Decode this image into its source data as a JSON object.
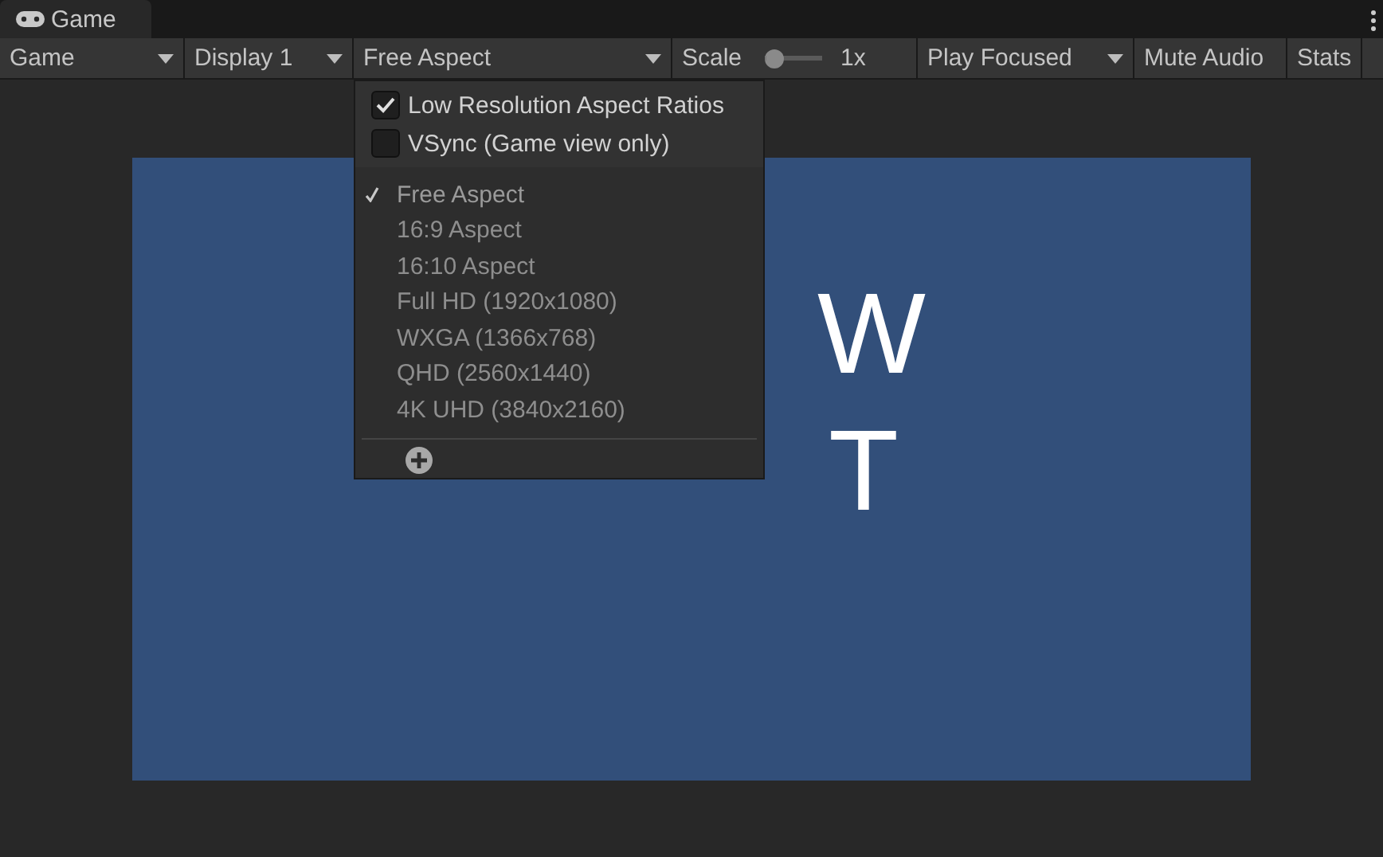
{
  "tab": {
    "title": "Game"
  },
  "toolbar": [
    {
      "kind": "dropdown",
      "label": "Game"
    },
    {
      "kind": "dropdown",
      "label": "Display 1"
    },
    {
      "kind": "dropdown",
      "label": "Free Aspect"
    },
    {
      "kind": "slider",
      "label": "Scale",
      "level": 0,
      "reading": "1x"
    },
    {
      "kind": "dropdown",
      "label": "Play Focused"
    },
    {
      "kind": "button",
      "label": "Mute Audio"
    },
    {
      "kind": "button",
      "label": "Stats"
    }
  ],
  "menu": {
    "options": [
      {
        "label": "Low Resolution Aspect Ratios",
        "checked": true
      },
      {
        "label": "VSync (Game view only)",
        "checked": false
      }
    ],
    "aspects": [
      {
        "label": "Free Aspect",
        "selected": true
      },
      {
        "label": "16:9 Aspect",
        "selected": false
      },
      {
        "label": "16:10 Aspect",
        "selected": false
      },
      {
        "label": "Full HD (1920x1080)",
        "selected": false
      },
      {
        "label": "WXGA (1366x768)",
        "selected": false
      },
      {
        "label": "QHD (2560x1440)",
        "selected": false
      },
      {
        "label": "4K UHD (3840x2160)",
        "selected": false
      }
    ]
  },
  "game_view": {
    "text_lines": [
      "W",
      "T"
    ]
  }
}
